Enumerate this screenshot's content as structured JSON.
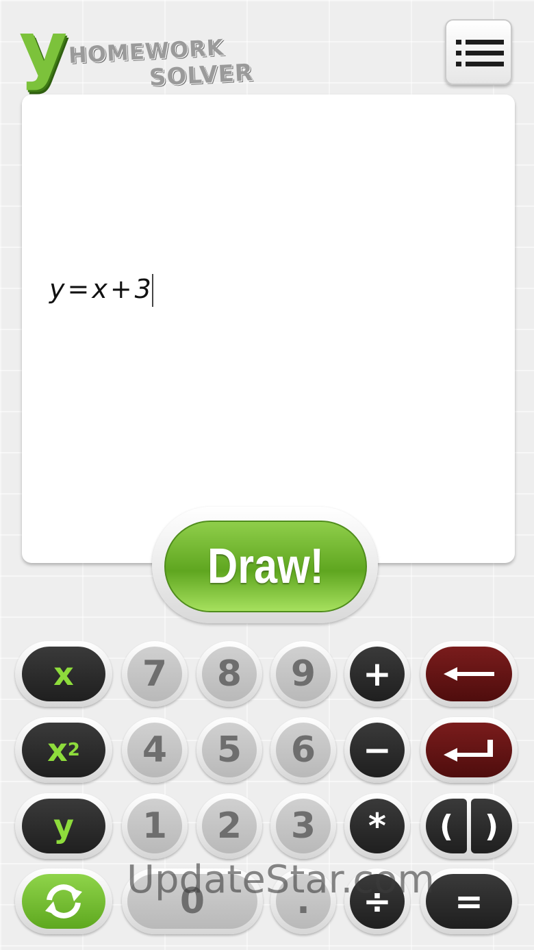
{
  "app": {
    "logo_letter": "y",
    "logo_line1": "HOMEWORK",
    "logo_line2": "SOLVER",
    "brand_color": "#7cc23b"
  },
  "menu": {
    "icon": "list-icon"
  },
  "canvas": {
    "expression": "y=x+3"
  },
  "draw_button": {
    "label": "Draw!"
  },
  "keypad": {
    "row1": {
      "var": "x",
      "d1": "7",
      "d2": "8",
      "d3": "9",
      "op": "+",
      "action_icon": "backspace-arrow-icon"
    },
    "row2": {
      "var_base": "x",
      "var_exp": "2",
      "d1": "4",
      "d2": "5",
      "d3": "6",
      "op": "−",
      "action_icon": "enter-arrow-icon"
    },
    "row3": {
      "var": "y",
      "d1": "1",
      "d2": "2",
      "d3": "3",
      "op": "*",
      "action_open": "(",
      "action_close": ")"
    },
    "row4": {
      "refresh_icon": "refresh-icon",
      "zero": "0",
      "dot": ".",
      "op": "÷",
      "equals": "="
    }
  },
  "watermark": "UpdateStar.com"
}
